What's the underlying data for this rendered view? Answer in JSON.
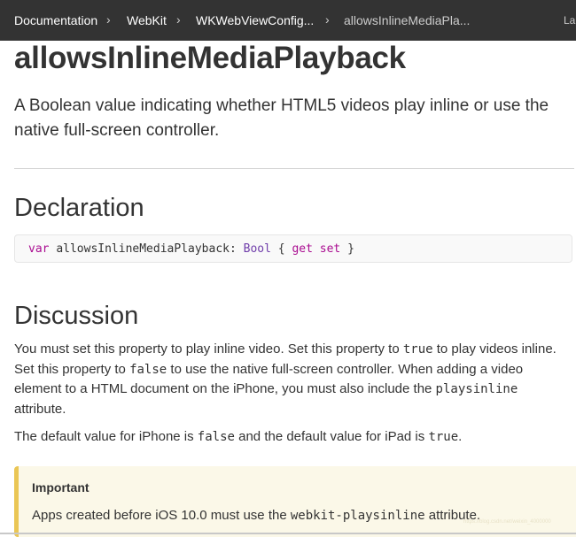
{
  "breadcrumbs": [
    {
      "label": "Documentation"
    },
    {
      "label": "WebKit"
    },
    {
      "label": "WKWebViewConfig..."
    },
    {
      "label": "allowsInlineMediaPla..."
    }
  ],
  "breadcrumb_separator": "›",
  "language_label": "La",
  "page": {
    "title": "allowsInlineMediaPlayback",
    "abstract": "A Boolean value indicating whether HTML5 videos play inline or use the native full-screen controller."
  },
  "declaration": {
    "heading": "Declaration",
    "keyword_var": "var",
    "name": "allowsInlineMediaPlayback:",
    "type": "Bool",
    "open_brace": "{",
    "keyword_get": "get",
    "keyword_set": "set",
    "close_brace": "}"
  },
  "discussion": {
    "heading": "Discussion",
    "p1_a": "You must set this property to play inline video. Set this property to ",
    "p1_code1": "true",
    "p1_b": " to play videos inline. Set this property to ",
    "p1_code2": "false",
    "p1_c": " to use the native full-screen controller. When adding a video element to a HTML document on the iPhone, you must also include the ",
    "p1_code3": "playsinline",
    "p1_d": " attribute.",
    "p2_a": "The default value for iPhone is ",
    "p2_code1": "false",
    "p2_b": " and the default value for iPad is ",
    "p2_code2": "true",
    "p2_c": "."
  },
  "important": {
    "title": "Important",
    "text_a": "Apps created before iOS 10.0 must use the ",
    "code": "webkit-playsinline",
    "text_b": " attribute."
  },
  "watermark": "https://blog.csdn.net/weixin_4000000",
  "colors": {
    "nav_bg": "#333333",
    "keyword": "#aa0d91",
    "type": "#703daa",
    "aside_bg": "#fbf8e8",
    "aside_border": "#eac655"
  }
}
